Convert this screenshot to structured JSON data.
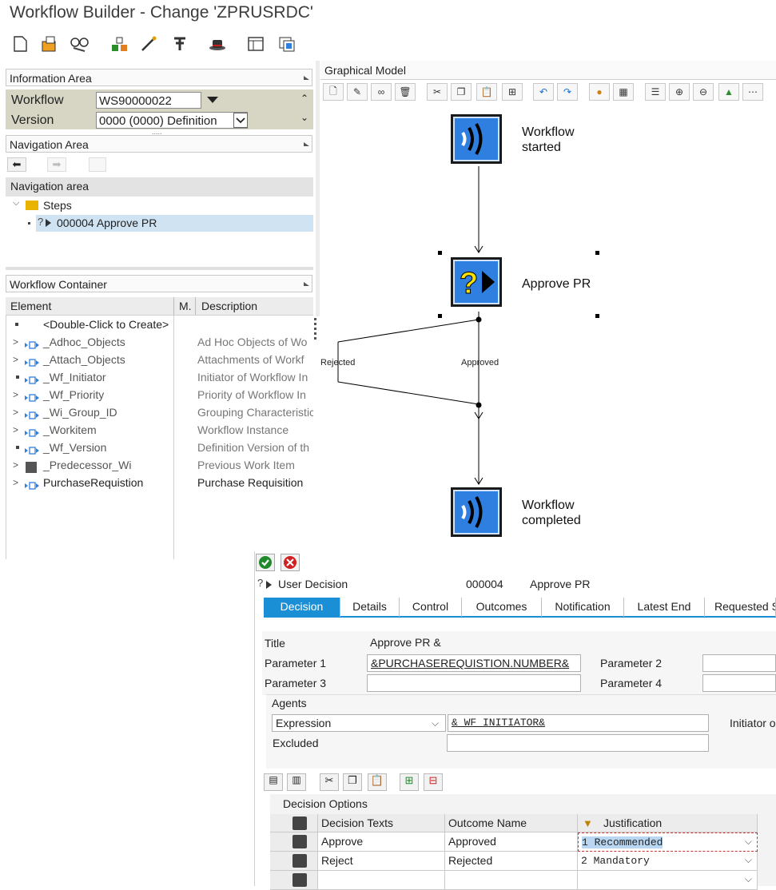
{
  "window": {
    "title": "Workflow Builder - Change 'ZPRUSRDC'"
  },
  "toolbar": {
    "icons": [
      "new-icon",
      "change-icon",
      "glasses-icon",
      "activate-icon",
      "wizard-icon",
      "test-icon",
      "hat-icon",
      "layout-icon",
      "copy-icon"
    ]
  },
  "info_area": {
    "header": "Information Area",
    "workflow_label": "Workflow",
    "workflow_value": "WS90000022",
    "version_label": "Version",
    "version_value": "0000 (0000) Definition"
  },
  "nav_area": {
    "header": "Navigation Area",
    "subheader": "Navigation area",
    "folder": "Steps",
    "step_prefix": "?",
    "step": "000004 Approve PR"
  },
  "workflow_container": {
    "header": "Workflow Container",
    "col_element": "Element",
    "col_m": "M.",
    "col_description": "Description",
    "create_row": "<Double-Click to Create>",
    "rows": [
      {
        "name": "_Adhoc_Objects",
        "desc": "Ad Hoc Objects of Wo"
      },
      {
        "name": "_Attach_Objects",
        "desc": "Attachments of Workf"
      },
      {
        "name": "_Wf_Initiator",
        "desc": "Initiator of Workflow In"
      },
      {
        "name": "_Wf_Priority",
        "desc": "Priority of Workflow In"
      },
      {
        "name": "_Wi_Group_ID",
        "desc": "Grouping Characteristic"
      },
      {
        "name": "_Workitem",
        "desc": "Workflow Instance"
      },
      {
        "name": "_Wf_Version",
        "desc": "Definition Version of th"
      },
      {
        "name": "_Predecessor_Wi",
        "desc": "Previous Work Item"
      },
      {
        "name": "PurchaseRequistion",
        "desc": "Purchase Requisition"
      }
    ]
  },
  "graph": {
    "header": "Graphical Model",
    "start_label_1": "Workflow",
    "start_label_2": "started",
    "step_label": "Approve PR",
    "end_label_1": "Workflow",
    "end_label_2": "completed",
    "branch_rejected": "Rejected",
    "branch_approved": "Approved"
  },
  "step_dialog": {
    "type": "User Decision",
    "number": "000004",
    "name": "Approve PR",
    "tabs": [
      "Decision",
      "Details",
      "Control",
      "Outcomes",
      "Notification",
      "Latest End",
      "Requested S"
    ],
    "title_label": "Title",
    "title_value": "Approve PR &",
    "param1_label": "Parameter 1",
    "param1_value": "&PURCHASEREQUISTION.NUMBER&",
    "param2_label": "Parameter 2",
    "param3_label": "Parameter 3",
    "param4_label": "Parameter 4",
    "agents_label": "Agents",
    "expression_label": "Expression",
    "expression_value": "&_WF_INITIATOR&",
    "initiator_trunc": "Initiator o",
    "excluded_label": "Excluded",
    "options_header": "Decision Options",
    "col_texts": "Decision Texts",
    "col_outcome": "Outcome Name",
    "col_justification": "Justification",
    "options": [
      {
        "text": "Approve",
        "outcome": "Approved",
        "justification": "1 Recommended"
      },
      {
        "text": "Reject",
        "outcome": "Rejected",
        "justification": "2 Mandatory"
      },
      {
        "text": "",
        "outcome": "",
        "justification": ""
      }
    ]
  },
  "colors": {
    "accent": "#2e7fe0",
    "tab_active": "#1a8fd6",
    "info_bg": "#d7d6c4"
  }
}
